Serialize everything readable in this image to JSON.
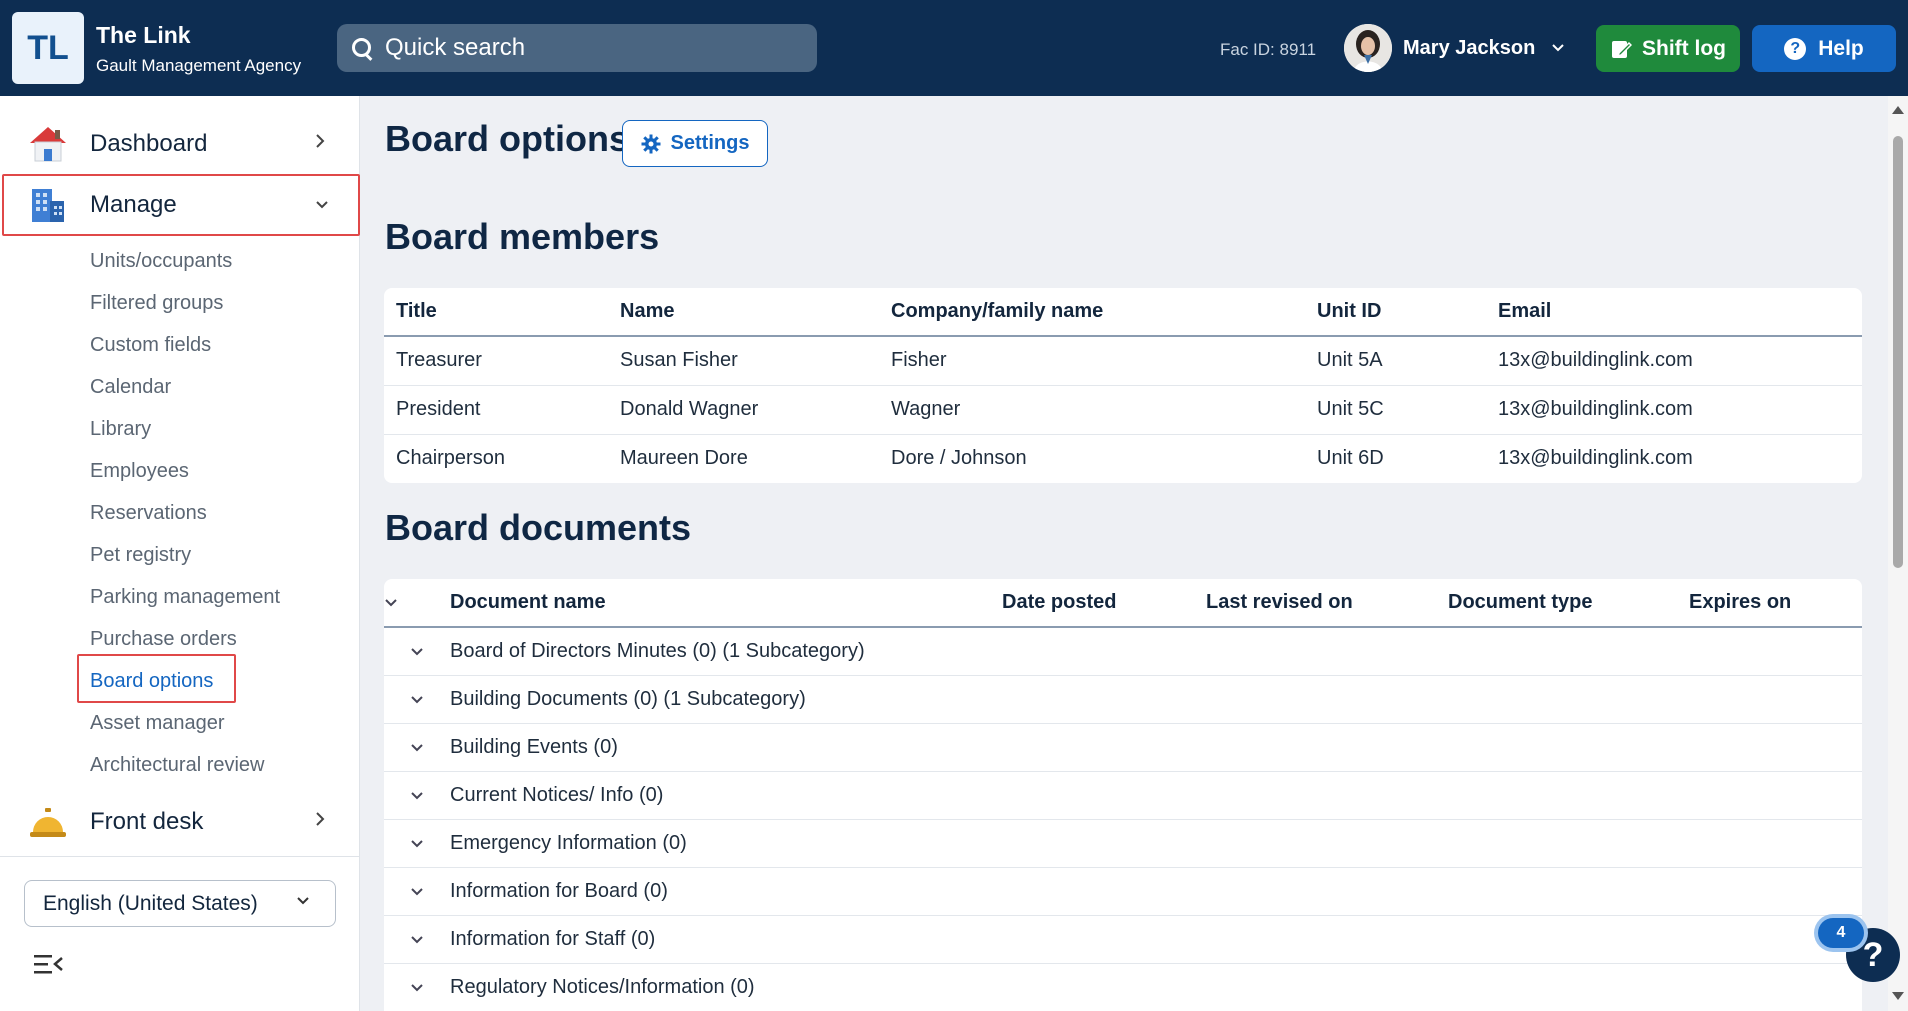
{
  "header": {
    "logo_text": "TL",
    "app_title": "The Link",
    "app_subtitle": "Gault Management Agency",
    "search_placeholder": "Quick search",
    "fac_id": "Fac ID: 8911",
    "user_name": "Mary Jackson",
    "shift_log_label": "Shift log",
    "help_label": "Help",
    "colors": {
      "header_bg": "#0d2d52",
      "shift_green": "#1f8a3c",
      "help_blue": "#1466c1"
    }
  },
  "sidebar": {
    "dashboard_label": "Dashboard",
    "manage_label": "Manage",
    "manage_items": [
      "Units/occupants",
      "Filtered groups",
      "Custom fields",
      "Calendar",
      "Library",
      "Employees",
      "Reservations",
      "Pet registry",
      "Parking management",
      "Purchase orders",
      "Board options",
      "Asset manager",
      "Architectural review"
    ],
    "front_desk_label": "Front desk",
    "language": "English (United States)"
  },
  "main": {
    "page_title": "Board options",
    "settings_label": "Settings",
    "members_title": "Board members",
    "members_headers": [
      "Title",
      "Name",
      "Company/family name",
      "Unit ID",
      "Email"
    ],
    "members_rows": [
      [
        "Treasurer",
        "Susan Fisher",
        "Fisher",
        "Unit 5A",
        "13x@buildinglink.com"
      ],
      [
        "President",
        "Donald Wagner",
        "Wagner",
        "Unit 5C",
        "13x@buildinglink.com"
      ],
      [
        "Chairperson",
        "Maureen Dore",
        "Dore / Johnson",
        "Unit 6D",
        "13x@buildinglink.com"
      ]
    ],
    "documents_title": "Board documents",
    "documents_headers": [
      "Document name",
      "Date posted",
      "Last revised on",
      "Document type",
      "Expires on"
    ],
    "documents_rows": [
      "Board of Directors Minutes (0) (1 Subcategory)",
      "Building Documents (0) (1 Subcategory)",
      "Building Events (0)",
      "Current Notices/ Info (0)",
      "Emergency Information (0)",
      "Information for Board (0)",
      "Information for Staff (0)",
      "Regulatory Notices/Information (0)"
    ]
  },
  "floating_help": {
    "badge_count": "4",
    "glyph": "?"
  }
}
